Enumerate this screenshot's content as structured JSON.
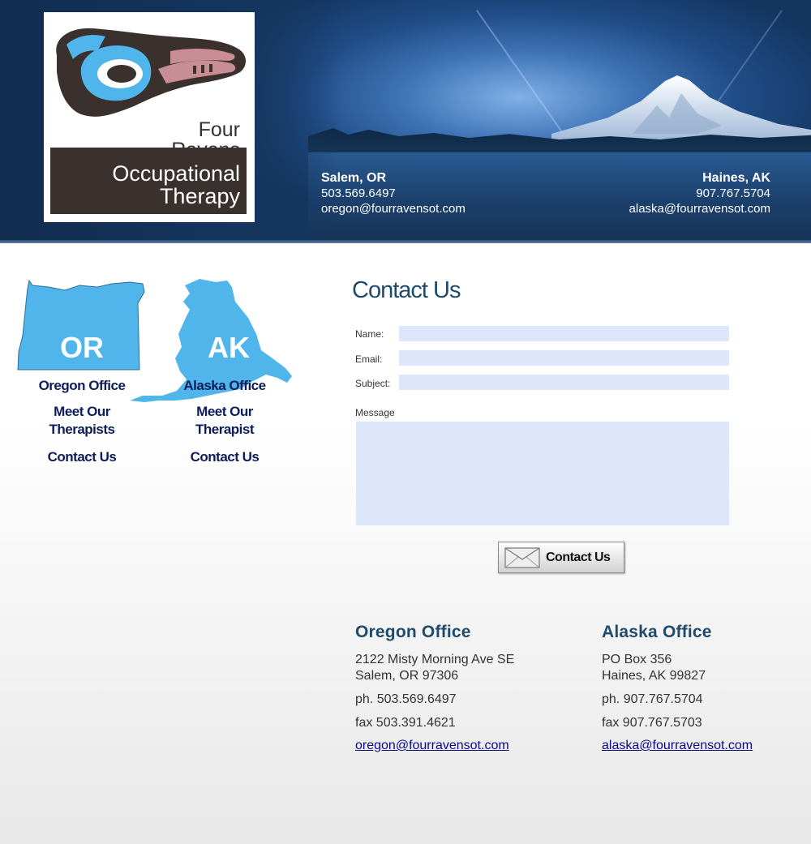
{
  "brand": {
    "line1": "Four",
    "line2": "Ravens",
    "line3": "Occupational",
    "line4": "Therapy"
  },
  "header": {
    "oregon": {
      "city": "Salem, OR",
      "phone": "503.569.6497",
      "email": "oregon@fourravensot.com"
    },
    "alaska": {
      "city": "Haines, AK",
      "phone": "907.767.5704",
      "email": "alaska@fourravensot.com"
    }
  },
  "nav": {
    "oregon": {
      "state": "OR",
      "office": "Oregon Office",
      "therapists_line1": "Meet Our",
      "therapists_line2": "Therapists",
      "contact": "Contact Us"
    },
    "alaska": {
      "state": "AK",
      "office": "Alaska Office",
      "therapists_line1": "Meet Our",
      "therapists_line2": "Therapist",
      "contact": "Contact Us"
    }
  },
  "form": {
    "title": "Contact Us",
    "name_label": "Name:",
    "email_label": "Email:",
    "subject_label": "Subject:",
    "message_label": "Message",
    "name_value": "",
    "email_value": "",
    "subject_value": "",
    "message_value": "",
    "submit_label": "Contact Us"
  },
  "offices": {
    "oregon": {
      "title": "Oregon Office",
      "address1": "2122 Misty Morning Ave SE",
      "address2": "Salem, OR  97306",
      "phone": "ph. 503.569.6497",
      "fax": "fax 503.391.4621",
      "email": "oregon@fourravensot.com"
    },
    "alaska": {
      "title": "Alaska Office",
      "address1": "PO Box 356",
      "address2": "Haines, AK  99827",
      "phone": "ph. 907.767.5704",
      "fax": "fax 907.767.5703",
      "email": "alaska@fourravensot.com"
    }
  },
  "colors": {
    "accent": "#1e4a6c",
    "nav_link": "#0d1c5a",
    "map_fill": "#4fb5ea",
    "field_bg": "#dde6fa",
    "logo_brown": "#3a302d",
    "logo_blue": "#4fb5ea",
    "logo_pink": "#c98e95"
  }
}
